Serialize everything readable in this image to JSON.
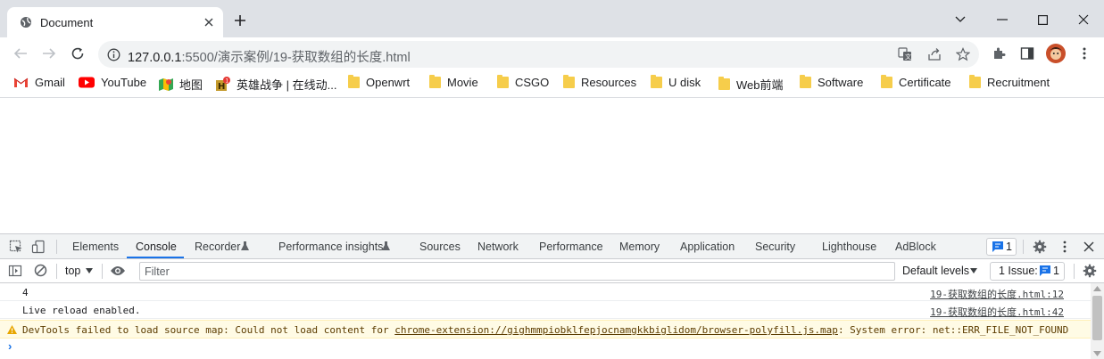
{
  "tab": {
    "title": "Document"
  },
  "omnibox": {
    "host": "127.0.0.1",
    "rest": ":5500/演示案例/19-获取数组的长度.html"
  },
  "bookmarks": [
    {
      "label": "Gmail",
      "icon": "gmail-icon"
    },
    {
      "label": "YouTube",
      "icon": "youtube-icon"
    },
    {
      "label": "地图",
      "icon": "maps-icon"
    },
    {
      "label": "英雄战争 | 在线动...",
      "icon": "game-icon"
    },
    {
      "label": "Openwrt",
      "icon": "folder-icon"
    },
    {
      "label": "Movie",
      "icon": "folder-icon"
    },
    {
      "label": "CSGO",
      "icon": "folder-icon"
    },
    {
      "label": "Resources",
      "icon": "folder-icon"
    },
    {
      "label": "U disk",
      "icon": "folder-icon"
    },
    {
      "label": "Web前端",
      "icon": "folder-icon"
    },
    {
      "label": "Software",
      "icon": "folder-icon"
    },
    {
      "label": "Certificate",
      "icon": "folder-icon"
    },
    {
      "label": "Recruitment",
      "icon": "folder-icon"
    }
  ],
  "devtools": {
    "tabs": [
      "Elements",
      "Console",
      "Recorder",
      "Performance insights",
      "Sources",
      "Network",
      "Performance",
      "Memory",
      "Application",
      "Security",
      "Lighthouse",
      "AdBlock"
    ],
    "active_tab": "Console",
    "issue_badge_count": "1",
    "context": "top",
    "filter_placeholder": "Filter",
    "levels": "Default levels",
    "issues_label": "1 Issue:",
    "issues_count": "1"
  },
  "console": {
    "line1": {
      "msg": "4",
      "src": "19-获取数组的长度.html:12"
    },
    "line2": {
      "msg": "Live reload enabled.",
      "src": "19-获取数组的长度.html:42"
    },
    "warn": {
      "prefix": "DevTools failed to load source map: Could not load content for ",
      "link": "chrome-extension://gighmmpiobklfepjocnamgkkbiglidom/browser-polyfill.js.map",
      "suffix": ": System error: net::ERR_FILE_NOT_FOUND"
    },
    "prompt": "›"
  },
  "colors": {
    "accent": "#1a73e8",
    "warn_bg": "#fffbe5",
    "tabbar": "#dee1e6"
  }
}
